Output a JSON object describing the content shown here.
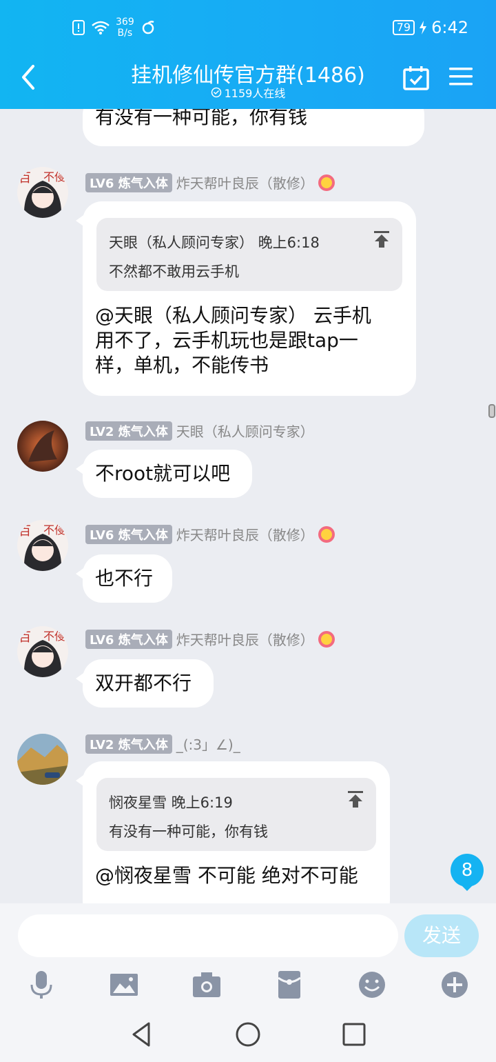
{
  "status_bar": {
    "net_speed_value": "369",
    "net_speed_unit": "B/s",
    "battery": "79",
    "time": "6:42"
  },
  "header": {
    "title": "挂机修仙传官方群(1486)",
    "online": "1159人在线"
  },
  "messages": [
    {
      "text": "有没有一种可能，你有钱"
    },
    {
      "badge": "LV6 炼气入体",
      "name": "炸天帮叶良辰（散修）",
      "quote_author": "天眼（私人顾问专家） 晚上6:18",
      "quote_text": "不然都不敢用云手机",
      "text_lines": [
        "@天眼（私人顾问专家） 云手机",
        "用不了，云手机玩也是跟tap一",
        "样，单机，不能传书"
      ]
    },
    {
      "badge": "LV2 炼气入体",
      "name": "天眼（私人顾问专家）",
      "text": "不root就可以吧"
    },
    {
      "badge": "LV6 炼气入体",
      "name": "炸天帮叶良辰（散修）",
      "text": "也不行"
    },
    {
      "badge": "LV6 炼气入体",
      "name": "炸天帮叶良辰（散修）",
      "text": "双开都不行"
    },
    {
      "badge": "LV2 炼气入体",
      "name": "_(:3」∠)_",
      "quote_author": "悯夜星雪 晚上6:19",
      "quote_text": "有没有一种可能，你有钱",
      "text": "@悯夜星雪 不可能 绝对不可能"
    }
  ],
  "unread_count": "8",
  "input": {
    "value": "",
    "send_label": "发送"
  },
  "toolbar": [
    "mic-icon",
    "image-icon",
    "camera-icon",
    "red-packet-icon",
    "emoji-icon",
    "plus-icon"
  ],
  "colors": {
    "accent": "#15b3f2",
    "badge": "#a9adb8",
    "background": "#ebedf2"
  }
}
